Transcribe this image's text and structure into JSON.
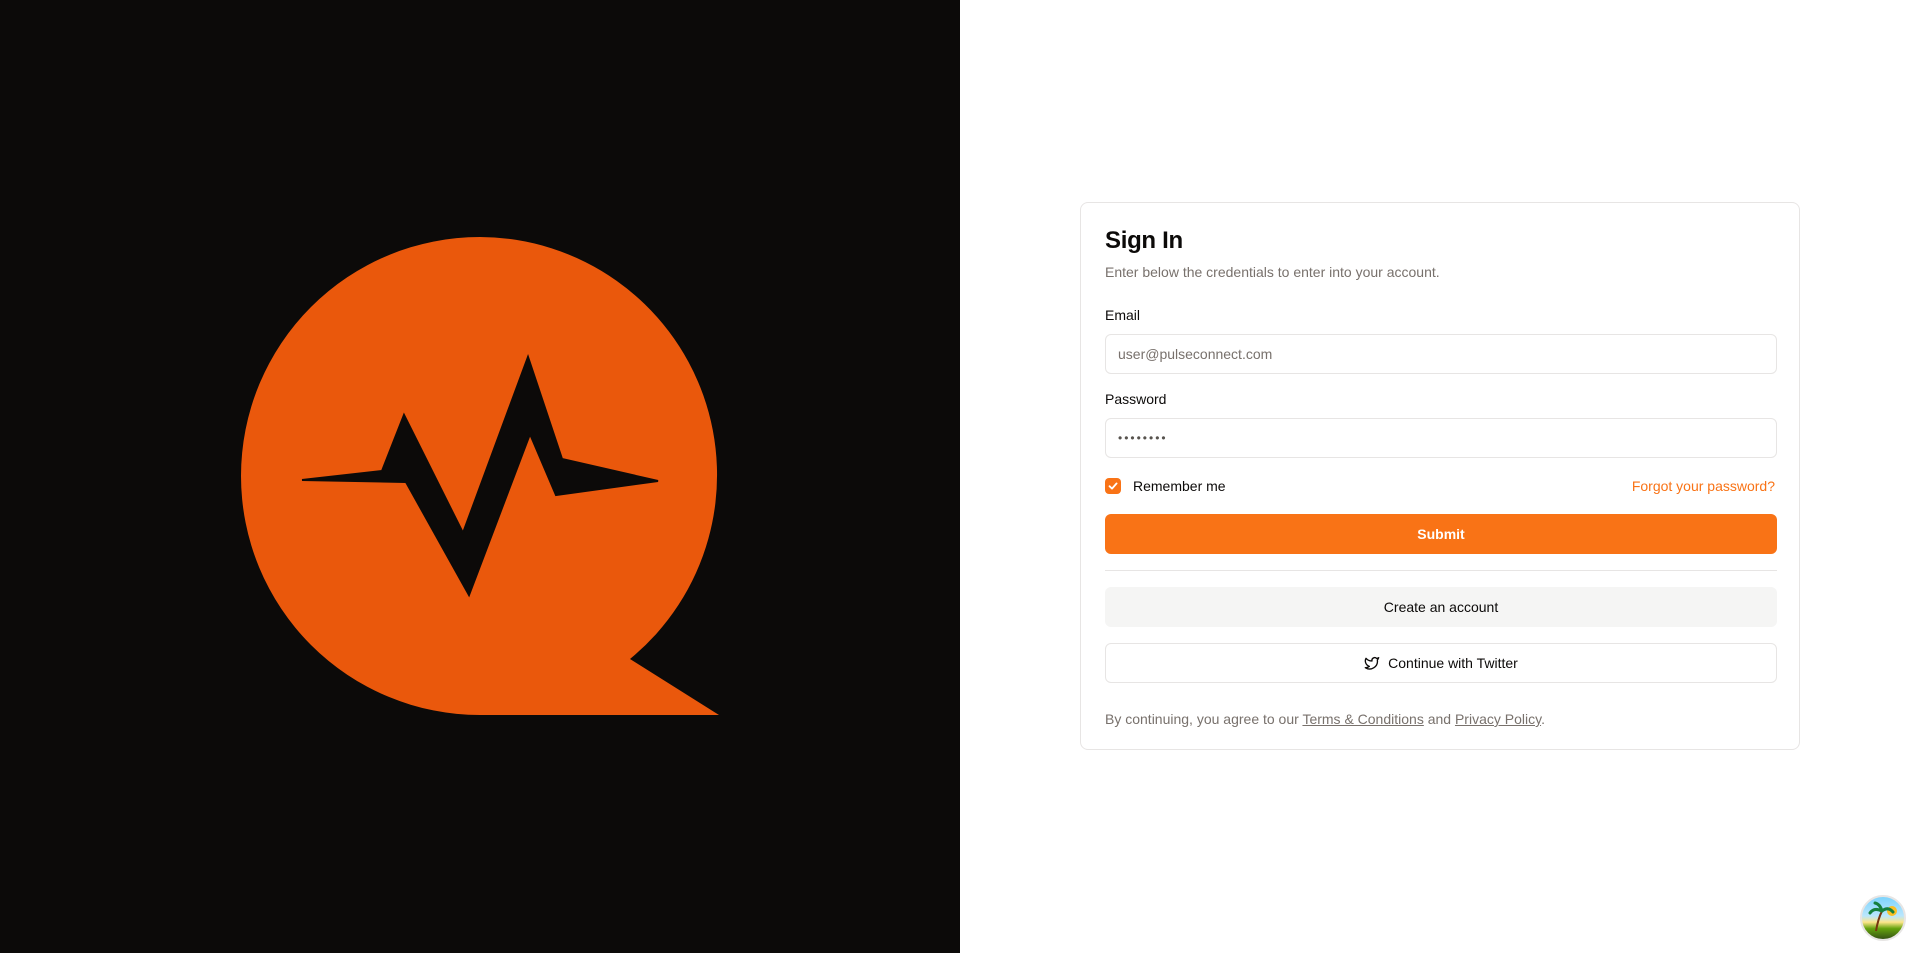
{
  "brand": {
    "logo_icon": "pulse-chat-bubble-icon",
    "logo_color": "#ea580c",
    "background_color": "#0c0a09"
  },
  "signin": {
    "title": "Sign In",
    "subtitle": "Enter below the credentials to enter into your account.",
    "email_label": "Email",
    "email_placeholder": "user@pulseconnect.com",
    "password_label": "Password",
    "password_value": "••••••••",
    "remember_label": "Remember me",
    "remember_checked": true,
    "forgot_label": "Forgot your password?",
    "submit_label": "Submit",
    "create_account_label": "Create an account",
    "twitter_label": "Continue with Twitter",
    "twitter_icon": "twitter-bird-icon",
    "terms_prefix": "By continuing, you agree to our ",
    "terms_link": "Terms & Conditions",
    "terms_middle": " and ",
    "privacy_link": "Privacy Policy",
    "terms_suffix": "."
  },
  "colors": {
    "accent": "#f97316",
    "muted_text": "#78716c",
    "border": "#e7e5e4",
    "secondary_bg": "#f5f5f4"
  },
  "corner_avatar_icon": "beach-avatar-icon"
}
